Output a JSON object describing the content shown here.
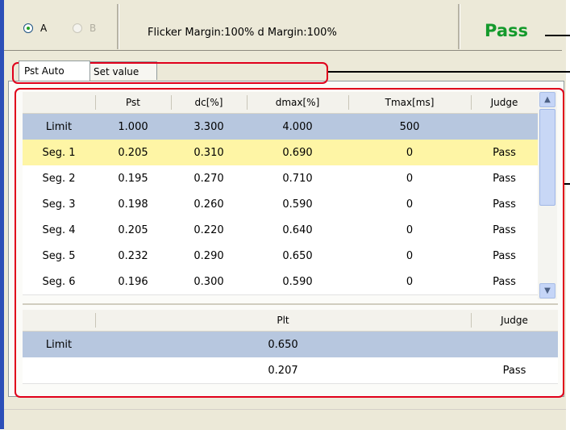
{
  "header": {
    "radio_a": "A",
    "radio_b": "B",
    "margin_text": "Flicker Margin:100%   d Margin:100%",
    "overall_result": "Pass"
  },
  "tabs": [
    {
      "label": "Pst Auto",
      "active": true
    },
    {
      "label": "Set value",
      "active": false
    }
  ],
  "pst_table": {
    "columns": [
      "",
      "Pst",
      "dc[%]",
      "dmax[%]",
      "Tmax[ms]",
      "Judge"
    ],
    "limit": {
      "label": "Limit",
      "pst": "1.000",
      "dc": "3.300",
      "dmax": "4.000",
      "tmax": "500",
      "judge": ""
    },
    "rows": [
      {
        "label": "Seg. 1",
        "pst": "0.205",
        "dc": "0.310",
        "dmax": "0.690",
        "tmax": "0",
        "judge": "Pass"
      },
      {
        "label": "Seg. 2",
        "pst": "0.195",
        "dc": "0.270",
        "dmax": "0.710",
        "tmax": "0",
        "judge": "Pass"
      },
      {
        "label": "Seg. 3",
        "pst": "0.198",
        "dc": "0.260",
        "dmax": "0.590",
        "tmax": "0",
        "judge": "Pass"
      },
      {
        "label": "Seg. 4",
        "pst": "0.205",
        "dc": "0.220",
        "dmax": "0.640",
        "tmax": "0",
        "judge": "Pass"
      },
      {
        "label": "Seg. 5",
        "pst": "0.232",
        "dc": "0.290",
        "dmax": "0.650",
        "tmax": "0",
        "judge": "Pass"
      },
      {
        "label": "Seg. 6",
        "pst": "0.196",
        "dc": "0.300",
        "dmax": "0.590",
        "tmax": "0",
        "judge": "Pass"
      }
    ]
  },
  "plt_table": {
    "columns": [
      "",
      "Plt",
      "Judge"
    ],
    "limit": {
      "label": "Limit",
      "plt": "0.650",
      "judge": ""
    },
    "result": {
      "label": "",
      "plt": "0.207",
      "judge": "Pass"
    }
  },
  "colors": {
    "pass_green": "#149a2c",
    "limit_row": "#b7c7df",
    "selected_row": "#fef5a5",
    "callout_red": "#e0001b"
  }
}
